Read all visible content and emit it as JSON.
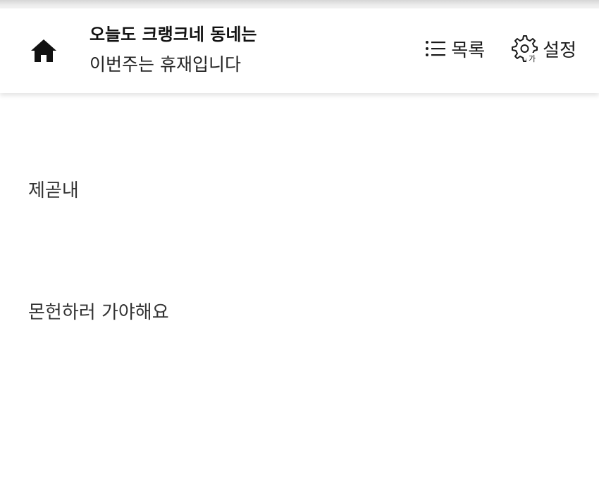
{
  "header": {
    "home_icon": "home-icon",
    "title": "오늘도 크랭크네 동네는",
    "subtitle": "이번주는 휴재입니다",
    "list_icon": "list-icon",
    "list_label": "목록",
    "settings_icon": "font-settings-gear-icon",
    "settings_icon_glyph": "가",
    "settings_label": "설정"
  },
  "content": {
    "paragraphs": [
      "제곧내",
      "몬헌하러 가야해요"
    ]
  }
}
